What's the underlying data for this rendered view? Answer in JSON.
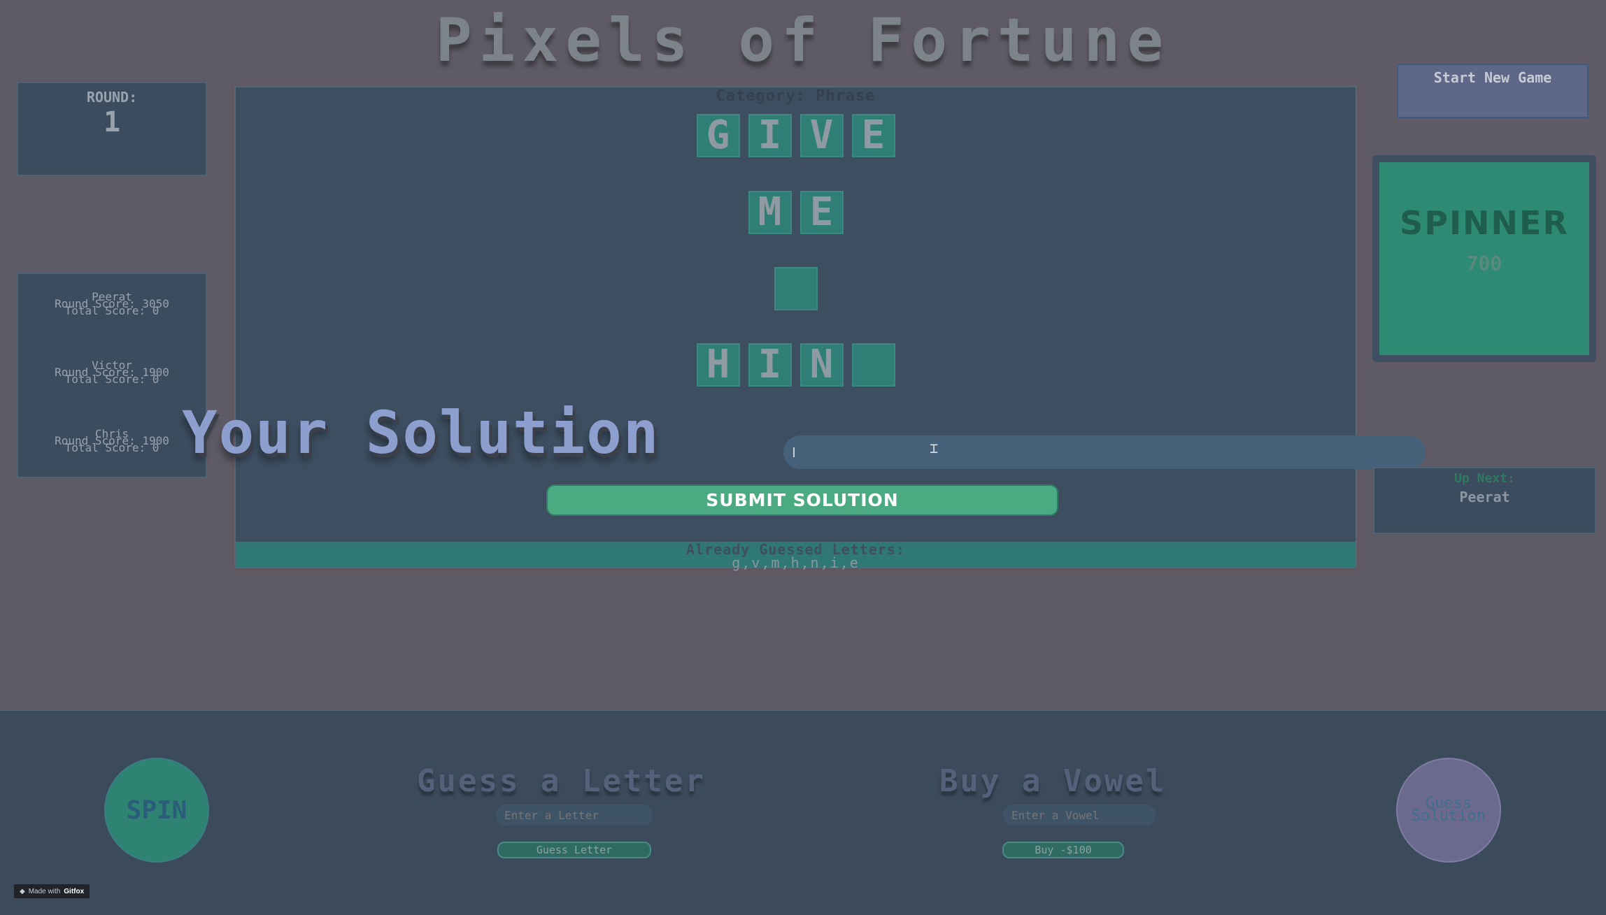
{
  "title": "Pixels of Fortune",
  "round": {
    "label": "ROUND:",
    "value": "1"
  },
  "players": [
    {
      "name": "Peerat",
      "round_score": "Round Score: 3050",
      "total_score": "Total Score: 0"
    },
    {
      "name": "Victor",
      "round_score": "Round Score: 1900",
      "total_score": "Total Score: 0"
    },
    {
      "name": "Chris",
      "round_score": "Round Score: 1900",
      "total_score": "Total Score: 0"
    }
  ],
  "board": {
    "category": "Category: Phrase",
    "rows": [
      [
        "G",
        "I",
        "V",
        "E"
      ],
      [
        "M",
        "E"
      ],
      [
        ""
      ],
      [
        "H",
        "I",
        "N",
        ""
      ]
    ],
    "guessed_label": "Already Guessed Letters:",
    "guessed_letters": "g,v,m,h,n,i,e"
  },
  "solution": {
    "heading": "Your Solution",
    "input_value": "",
    "submit_label": "SUBMIT SOLUTION"
  },
  "start_new_game": "Start New Game",
  "spinner": {
    "title": "SPINNER",
    "value": "700"
  },
  "up_next": {
    "label": "Up Next:",
    "name": "Peerat"
  },
  "controls": {
    "spin_label": "SPIN",
    "guess_letter_title": "Guess a Letter",
    "letter_placeholder": "Enter a Letter",
    "guess_letter_button": "Guess Letter",
    "buy_vowel_title": "Buy a Vowel",
    "vowel_placeholder": "Enter a Vowel",
    "buy_button": "Buy -$100",
    "guess_solution_label": "Guess Solution"
  },
  "badge": {
    "text": "Made with",
    "brand": "Gitfox"
  },
  "colors": {
    "tile": "#2f7f76",
    "spinner": "#2e8a73",
    "submit": "#4caa82",
    "board": "#3c4e60"
  }
}
